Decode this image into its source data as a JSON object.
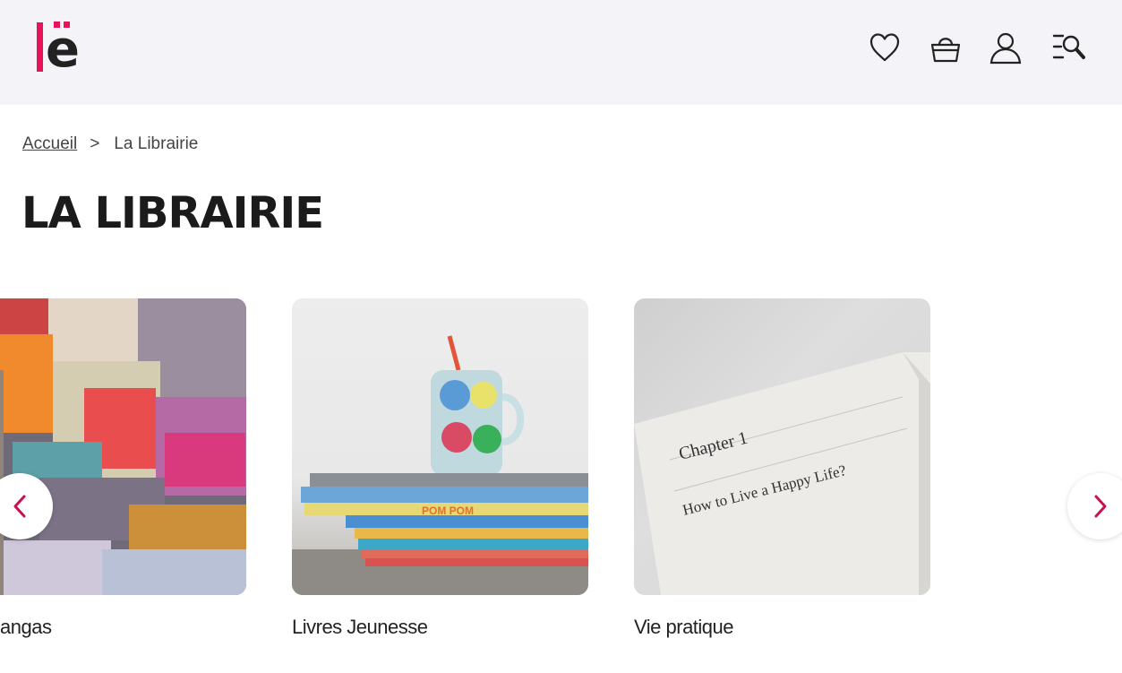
{
  "header": {
    "logo_alt": "lë",
    "icons": [
      "heart-icon",
      "basket-icon",
      "user-icon",
      "menu-search-icon"
    ]
  },
  "breadcrumb": {
    "home": "Accueil",
    "separator": ">",
    "current": "La Librairie"
  },
  "page": {
    "title": "LA LIBRAIRIE"
  },
  "carousel": {
    "items": [
      {
        "label": "Mangas",
        "visible_label": "angas"
      },
      {
        "label": "Livres Jeunesse",
        "visible_label": "Livres Jeunesse"
      },
      {
        "label": "Vie pratique",
        "visible_label": "Vie pratique"
      }
    ],
    "book_page": {
      "chapter": "Chapter  1",
      "heading": "How to Live a Happy Life?"
    },
    "stack_title": "POM POM"
  },
  "colors": {
    "accent": "#e6135a",
    "header_bg": "#f3f3f8",
    "text": "#1a1a1a"
  }
}
